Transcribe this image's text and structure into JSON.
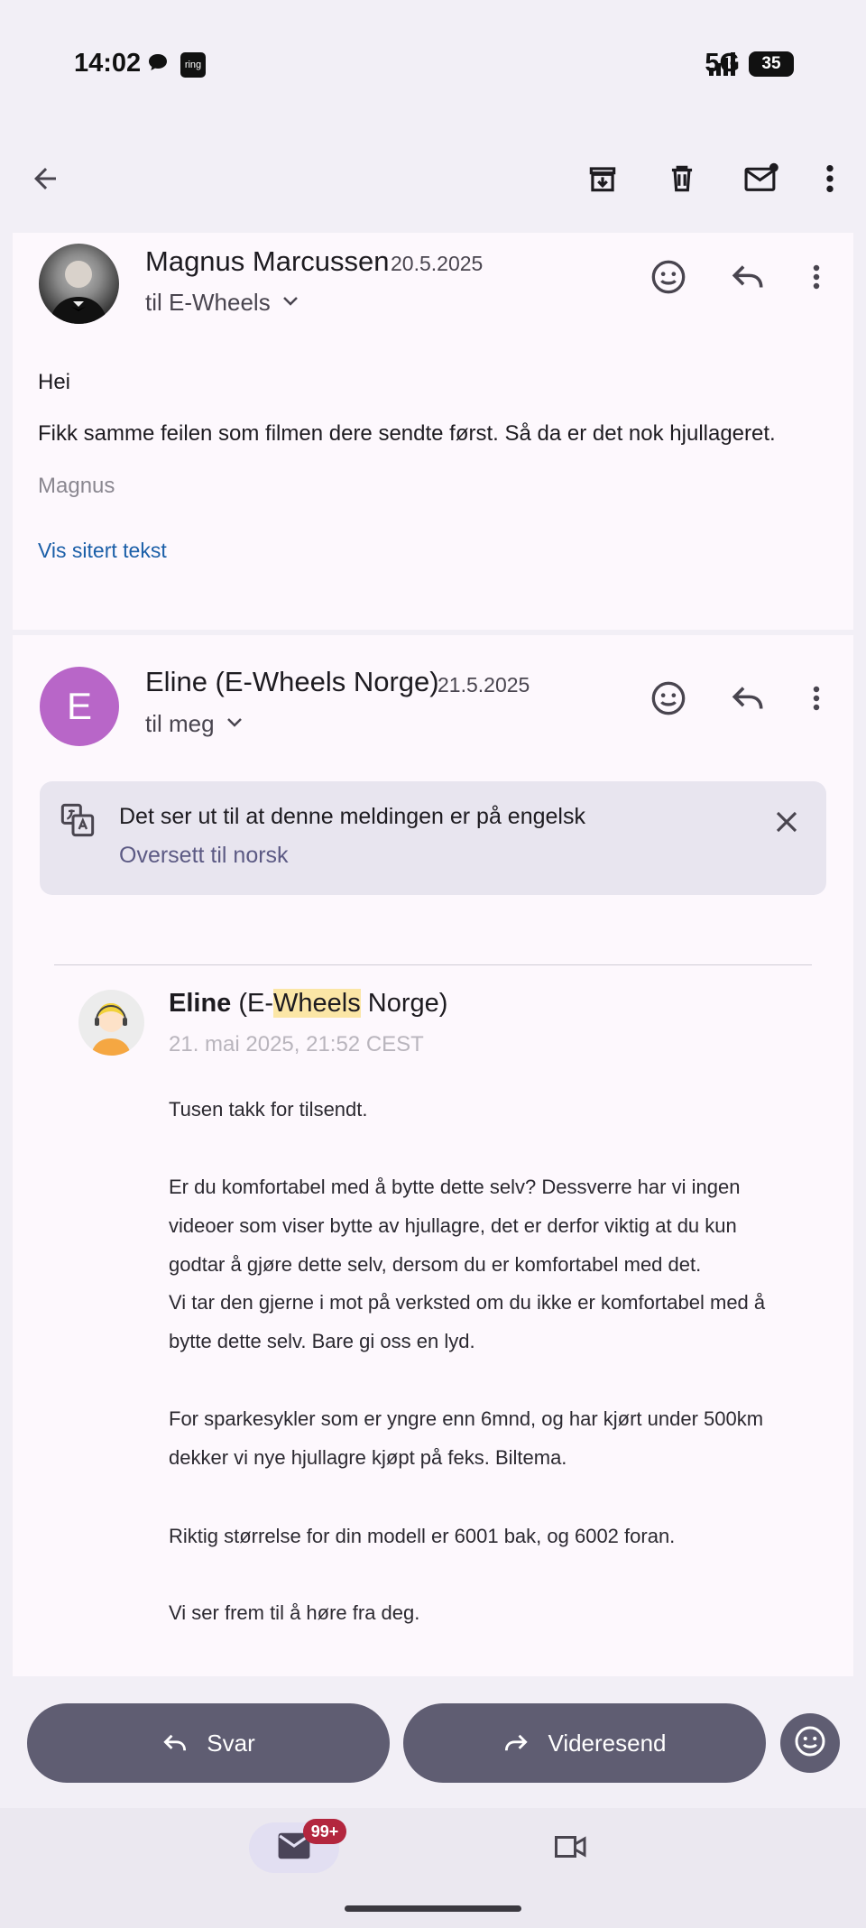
{
  "status_bar": {
    "time": "14:02",
    "ring_label": "ring",
    "network": "5G",
    "battery": "35"
  },
  "toolbar": {
    "back": "arrow-left-icon",
    "archive": "archive-icon",
    "delete": "trash-icon",
    "mark_unread": "mail-unread-icon",
    "more": "more-vert-icon"
  },
  "message1": {
    "sender": "Magnus Marcussen",
    "date": "20.5.2025",
    "to": "til E-Wheels",
    "body": [
      "Hei",
      "Fikk samme feilen som filmen dere sendte først. Så da er det nok hjullageret."
    ],
    "signature": "Magnus",
    "show_quoted": "Vis sitert tekst"
  },
  "message2": {
    "avatar_letter": "E",
    "avatar_color": "#b866c8",
    "sender": "Eline (E-Wheels Norge)",
    "date": "21.5.2025",
    "to": "til meg",
    "translate_banner": {
      "text": "Det ser ut til at denne meldingen er på engelsk",
      "link": "Oversett til norsk"
    },
    "quoted": {
      "name_bold": "Eline",
      "name_pre": " (E-",
      "name_highlight": "Wheels",
      "name_post": " Norge)",
      "date": "21. mai 2025, 21:52 CEST",
      "lines": [
        "Tusen takk for tilsendt.",
        "Er du komfortabel med å bytte dette selv? Dessverre har vi ingen",
        "videoer som viser bytte av hjullagre, det er derfor viktig at du kun",
        "godtar å gjøre dette selv, dersom du er komfortabel med det.",
        "Vi tar den gjerne i mot på verksted om du ikke er komfortabel med å",
        "bytte dette selv. Bare gi oss en lyd.",
        "For sparkesykler som er yngre enn 6mnd, og har kjørt under 500km",
        "dekker vi nye hjullagre kjøpt på feks. Biltema.",
        "Riktig størrelse for din modell er 6001 bak, og 6002 foran.",
        "Vi ser frem til å høre fra deg."
      ]
    }
  },
  "actions": {
    "reply": "Svar",
    "forward": "Videresend"
  },
  "bottom_nav": {
    "mail_badge": "99+"
  },
  "colors": {
    "accent": "#5f5d72",
    "badge": "#b3263e",
    "link": "#1b5fa8"
  }
}
